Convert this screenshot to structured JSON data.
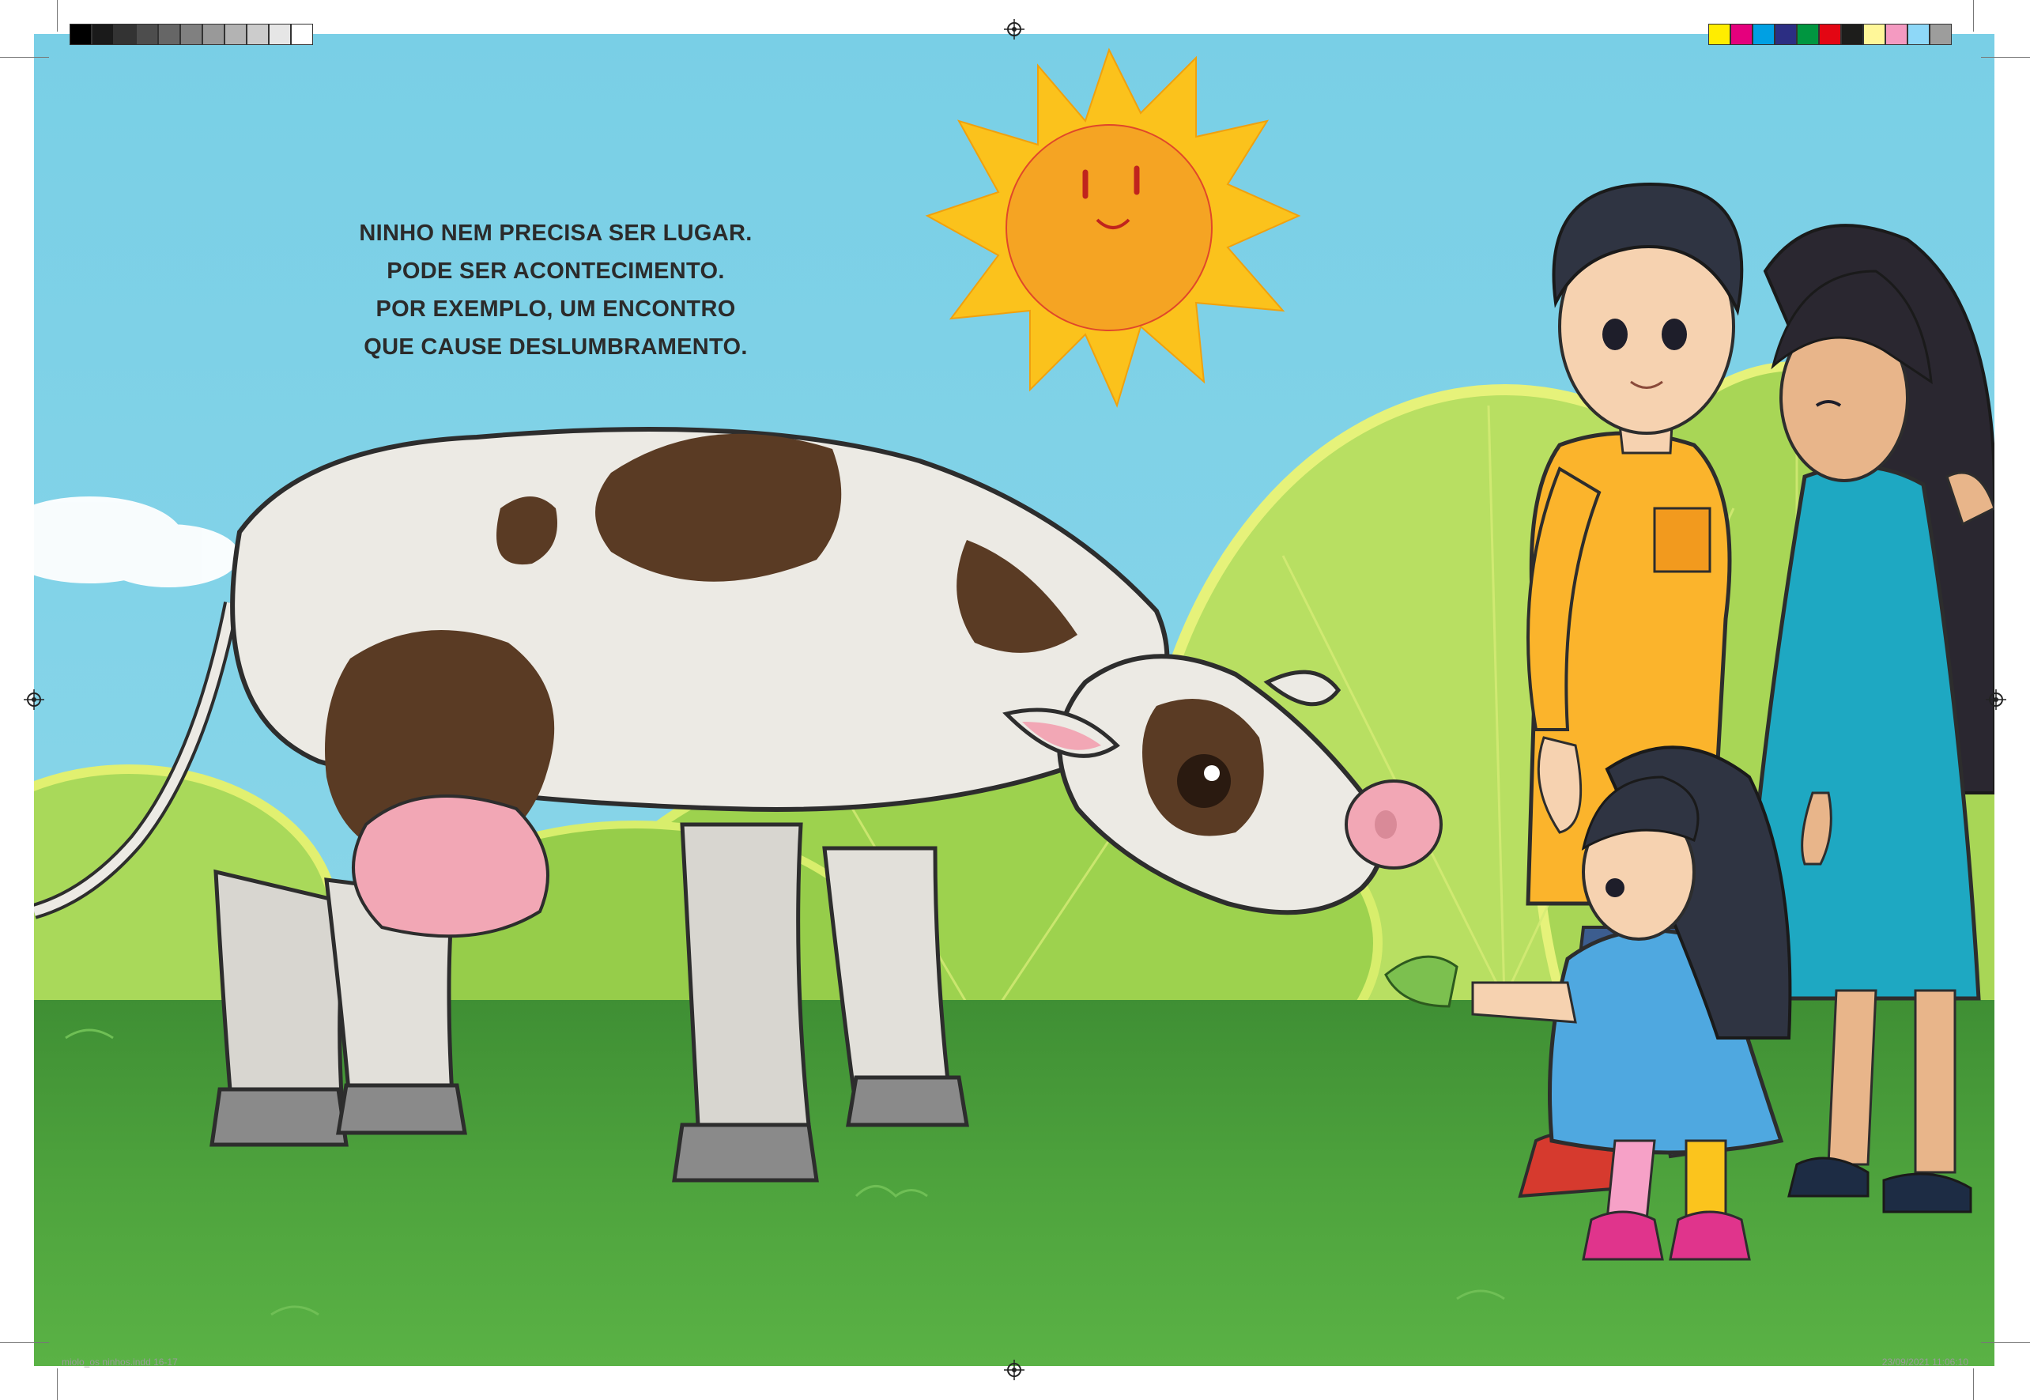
{
  "page": {
    "text_lines": [
      "NINHO NEM PRECISA SER LUGAR.",
      "PODE SER ACONTECIMENTO.",
      "POR EXEMPLO, UM ENCONTRO",
      "QUE CAUSE DESLUMBRAMENTO."
    ]
  },
  "print_marks": {
    "slug_left": "miolo_os ninhos.indd   16-17",
    "slug_right": "23/09/2021   11:06:10",
    "grayscale_swatches": [
      "#000000",
      "#1a1a1a",
      "#333333",
      "#4d4d4d",
      "#666666",
      "#808080",
      "#999999",
      "#b3b3b3",
      "#cccccc",
      "#e6e6e6",
      "#ffffff"
    ],
    "color_swatches": [
      "#ffed00",
      "#e5007d",
      "#00a0e3",
      "#2c2e83",
      "#009640",
      "#e30613",
      "#1d1d1b",
      "#fff799",
      "#f49ac1",
      "#8ed8f8",
      "#9d9d9c"
    ]
  },
  "colors": {
    "sky": "#7ed1e6",
    "grass": "#4a9a3a",
    "sun_rays": "#fbc21c",
    "sun_face": "#f5a423",
    "cow_body": "#eceae4",
    "cow_spots": "#5a3b24",
    "udder": "#f2a7b5",
    "man_shirt": "#fbb42c",
    "woman_dress": "#1ea8c2",
    "girl_dress": "#4fa8e0"
  },
  "icons": {
    "registration_mark": "crosshair-circle-icon"
  }
}
